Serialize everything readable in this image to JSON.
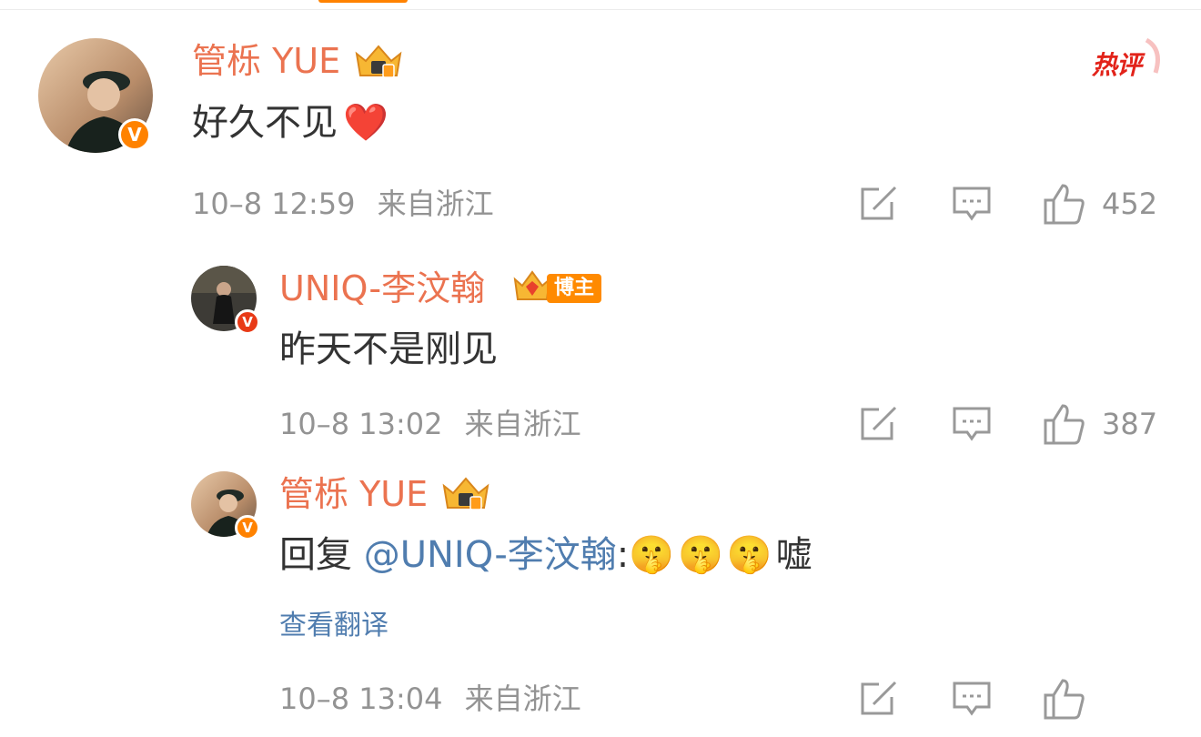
{
  "hot_label": "热评",
  "comments": [
    {
      "user": "管栎 YUE",
      "text": "好久不见",
      "emoji": "❤️",
      "time": "10–8 12:59",
      "location": "来自浙江",
      "likes": "452"
    },
    {
      "user": "UNIQ-李汶翰",
      "user_tag": "博主",
      "text": "昨天不是刚见",
      "time": "10–8 13:02",
      "location": "来自浙江",
      "likes": "387"
    },
    {
      "user": "管栎 YUE",
      "reply_prefix": "回复",
      "mention": "@UNIQ-李汶翰",
      "colon": ":",
      "emojis": "🤫🤫🤫",
      "suffix": "嘘",
      "translate": "查看翻译",
      "time": "10–8 13:04",
      "location": "来自浙江"
    }
  ],
  "icons": {
    "verified": "v-badge-icon",
    "crown": "crown-icon",
    "repost": "repost-icon",
    "comment": "comment-icon",
    "like": "thumb-up-icon"
  },
  "colors": {
    "username": "#eb7350",
    "mention": "#507daf",
    "meta": "#939393",
    "verified": "#ff8200",
    "hot": "#e2231a"
  }
}
